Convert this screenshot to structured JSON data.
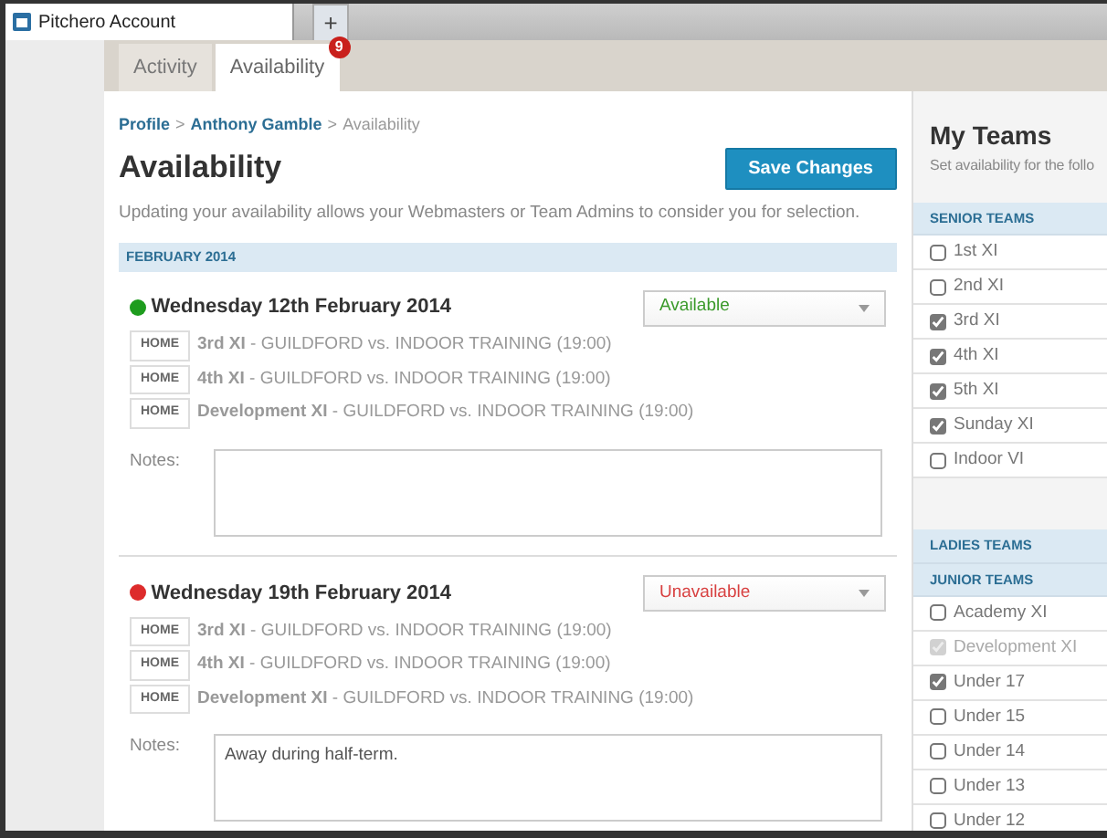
{
  "browser_tab": {
    "title": "Pitchero Account",
    "new_tab": "+"
  },
  "tabs": [
    {
      "label": "Activity",
      "selected": false
    },
    {
      "label": "Availability",
      "selected": true,
      "badge": "9"
    }
  ],
  "breadcrumb": [
    {
      "label": "Profile",
      "kind": "link"
    },
    {
      "label": ">",
      "kind": "sep"
    },
    {
      "label": "Anthony Gamble",
      "kind": "link"
    },
    {
      "label": ">",
      "kind": "sep"
    },
    {
      "label": "Availability",
      "kind": "current"
    }
  ],
  "title": "Availability",
  "save_button": "Save Changes",
  "description": "Updating your availability allows your Webmasters or Team Admins to consider you for selection.",
  "month": "FEBRUARY 2014",
  "events": [
    {
      "date": "Wednesday 12th February 2014",
      "color": "#1e9c1e",
      "status": {
        "kind": "available",
        "label": "Available"
      },
      "fixtures": [
        {
          "venue": "HOME",
          "text": "**3rd XI** - GUILDFORD vs. INDOOR TRAINING (19:00)"
        },
        {
          "venue": "HOME",
          "text": "**4th XI** - GUILDFORD vs. INDOOR TRAINING (19:00)"
        },
        {
          "venue": "HOME",
          "text": "**Development XI** - GUILDFORD vs. INDOOR TRAINING (19:00)"
        }
      ],
      "notes_label": "Notes:"
    },
    {
      "date": "Wednesday 19th February 2014",
      "color": "#dd2b2b",
      "status": {
        "kind": "unavailable",
        "label": "Unavailable"
      },
      "fixtures": [
        {
          "venue": "HOME",
          "text": "**3rd XI** - GUILDFORD vs. INDOOR TRAINING (19:00)"
        },
        {
          "venue": "HOME",
          "text": "**4th XI** - GUILDFORD vs. INDOOR TRAINING (19:00)"
        },
        {
          "venue": "HOME",
          "text": "**Development XI** - GUILDFORD vs. INDOOR TRAINING (19:00)"
        }
      ],
      "notes_label": "Notes:",
      "notes": "Away during half-term."
    }
  ],
  "sidebar": {
    "title": "My Teams",
    "subtitle": "Set availability for the follo",
    "sections": [
      {
        "heading": "SENIOR TEAMS",
        "teams": [
          {
            "name": "1st XI",
            "checked": false,
            "disabled": false
          },
          {
            "name": "2nd XI",
            "checked": false,
            "disabled": false
          },
          {
            "name": "3rd XI",
            "checked": true,
            "disabled": false
          },
          {
            "name": "4th XI",
            "checked": true,
            "disabled": false
          },
          {
            "name": "5th XI",
            "checked": true,
            "disabled": false
          },
          {
            "name": "Sunday XI",
            "checked": true,
            "disabled": false
          },
          {
            "name": "Indoor VI",
            "checked": false,
            "disabled": false
          }
        ]
      },
      {
        "heading": "LADIES TEAMS"
      },
      {
        "heading": "JUNIOR TEAMS",
        "teams": [
          {
            "name": "Academy XI",
            "checked": false,
            "disabled": false
          },
          {
            "name": "Development XI",
            "checked": true,
            "disabled": true
          },
          {
            "name": "Under 17",
            "checked": true,
            "disabled": false
          },
          {
            "name": "Under 15",
            "checked": false,
            "disabled": false
          },
          {
            "name": "Under 14",
            "checked": false,
            "disabled": false
          },
          {
            "name": "Under 13",
            "checked": false,
            "disabled": false
          },
          {
            "name": "Under 12",
            "checked": false,
            "disabled": false
          }
        ]
      }
    ]
  }
}
